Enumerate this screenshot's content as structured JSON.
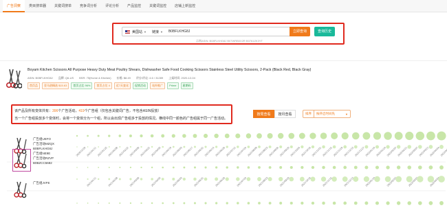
{
  "tabs": [
    {
      "label": "广告洞察",
      "active": true
    },
    {
      "label": "类目搜单器",
      "active": false
    },
    {
      "label": "关键词搜单",
      "active": false
    },
    {
      "label": "竞争词分析",
      "active": false
    },
    {
      "label": "评论分析",
      "active": false
    },
    {
      "label": "产品监控",
      "active": false
    },
    {
      "label": "关键词监控",
      "active": false
    },
    {
      "label": "店铺上新监控",
      "active": false
    }
  ],
  "search": {
    "market": "美国站",
    "field_type": "链接",
    "value": "B0BFLKHG8J",
    "query_label": "立即查询",
    "history_label": "查询历史",
    "examples": "示例ASIN:  B08FLKHG8J  B07WRB0X2R  B0761ZK3YT"
  },
  "product": {
    "title": "Boyam Kitchen Scissors All Purpose Heavy Duty Meat Poultry Shears, Dishwasher Safe Food Cooking Scissors Stainless Steel Utility Scissors, 2-Pack (Black Red, Black Gray)",
    "meta": [
      "ASIN: B0BFLKHG8J",
      "品牌: Q6-US",
      "BSR: 75(Home & Kitchen)",
      "价格: $8.49",
      "评分/评论: 4.6 / 31289",
      "上架时间: 2020-12-04"
    ],
    "badges": [
      {
        "text": "首页品",
        "style": "orange"
      },
      {
        "text": "亚马逊精选 $15.63",
        "style": "orange"
      },
      {
        "text": "首页占比 96%",
        "style": "green"
      },
      {
        "text": "首页占位 4",
        "style": "orange"
      },
      {
        "text": "近7天变化",
        "style": "orange"
      },
      {
        "text": "促销活动",
        "style": "green"
      },
      {
        "text": "站外推广",
        "style": "orange"
      },
      {
        "text": "Prime",
        "style": "green"
      },
      {
        "text": "星期码",
        "style": "green"
      }
    ]
  },
  "info": {
    "line1_prefix": "该产品及所有变体共有：",
    "count_a": "396",
    "line1_mid": "个广告活动，",
    "count_b": "419",
    "line1_suffix": "个广告组（仅包含关键词广告，不包含ASIN投放）",
    "line2": "当一个广告组投放多个变体时，会将一个变体分为一个组，所以会出现广告组多于投放的情况。横线中同一颜色的广告组属于同一广告活动。"
  },
  "view": {
    "buttons": [
      {
        "label": "按周查看",
        "on": true
      },
      {
        "label": "按月查看",
        "on": false
      }
    ],
    "sort_label": "排序",
    "sort_value": "按开启时间先"
  },
  "rows": [
    {
      "line1": "广告组UEFO",
      "line2": "广告活动MZQX",
      "line3": "B0BFLKHG8J"
    },
    {
      "line1": "广告组NE9E",
      "line2": "广告活动RZVP",
      "line3": "B0BZCC5682"
    },
    {
      "line1": "广告组JVFE",
      "line2": "",
      "line3": ""
    }
  ],
  "timeline": {
    "dates": [
      "2020/12/28",
      "2021/01/11",
      "2021/01/25",
      "2021/02/08",
      "2021/02/22",
      "2021/03/08",
      "2021/03/22",
      "2021/04/05",
      "2021/04/19",
      "2021/05/03",
      "2021/05/17",
      "2021/05/31",
      "2021/06/14",
      "2021/06/28",
      "2021/07/12",
      "2021/07/26",
      "2021/08/09",
      "2021/08/23",
      "2021/09/06",
      "2021/09/20",
      "2021/10/04",
      "2021/10/18",
      "2021/11/01",
      "2021/11/15",
      "2021/11/29",
      "2021/12/13",
      "2021/12/27",
      "2022/01/10",
      "2022/01/24",
      "2022/02/07",
      "2022/02/21",
      "2022/03/07",
      "2022/03/21",
      "2022/04/04",
      "2022/04/18"
    ],
    "colors": [
      "#c8e6a8",
      "#d4ecbc"
    ]
  }
}
